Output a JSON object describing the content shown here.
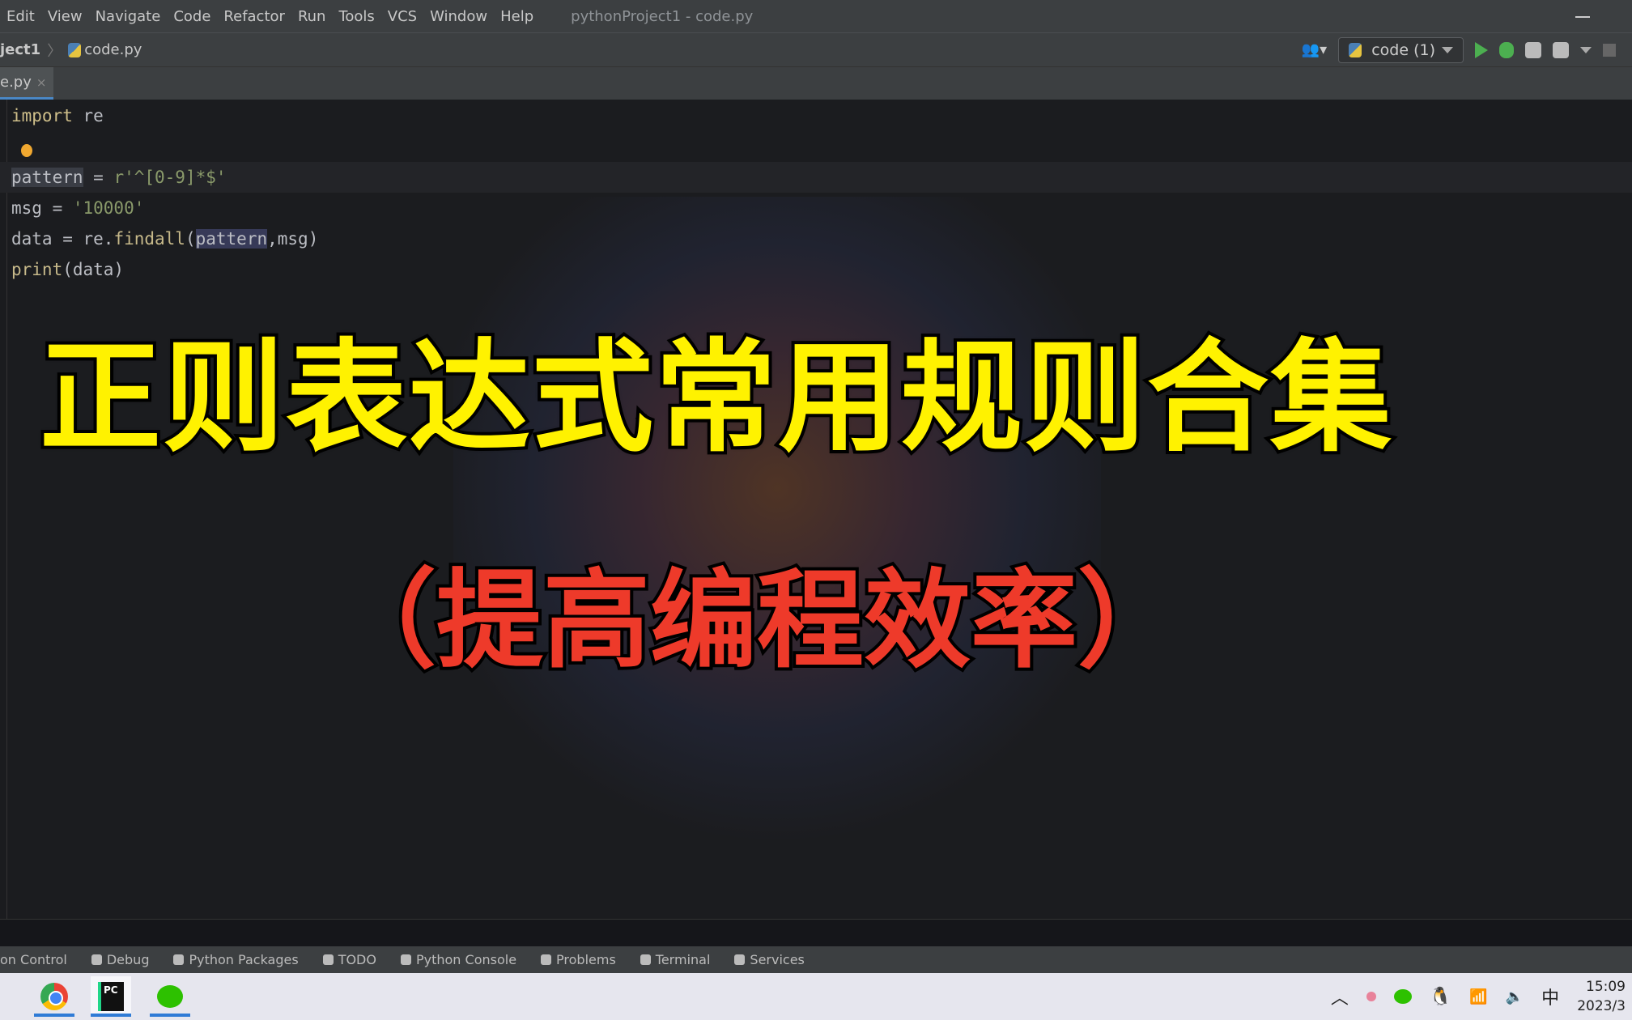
{
  "menubar": {
    "items": [
      "Edit",
      "View",
      "Navigate",
      "Code",
      "Refactor",
      "Run",
      "Tools",
      "VCS",
      "Window",
      "Help"
    ],
    "title": "pythonProject1 - code.py"
  },
  "navbar": {
    "project": "ject1",
    "file": "code.py",
    "run_config": "code (1)"
  },
  "tab": {
    "label": "e.py",
    "close": "×"
  },
  "code": {
    "line1": {
      "kw": "import",
      "rest": " re"
    },
    "line3": {
      "var": "pattern",
      "eq": " = ",
      "str": "r'^[0-9]*$'"
    },
    "line4": {
      "var": "msg = ",
      "str": "'10000'"
    },
    "line5": {
      "a": "data = re.",
      "fn": "findall",
      "b": "(",
      "hl": "pattern",
      "c": ",msg)"
    },
    "line6": {
      "fn": "print",
      "rest": "(data)"
    }
  },
  "overlay": {
    "title": "正则表达式常用规则合集",
    "subtitle": "（提高编程效率）",
    "title_color": "#fff200",
    "subtitle_color": "#ee3a2a"
  },
  "toolwindows": [
    "on Control",
    "Debug",
    "Python Packages",
    "TODO",
    "Python Console",
    "Problems",
    "Terminal",
    "Services"
  ],
  "taskbar": {
    "ime": "中",
    "time": "15:09",
    "date": "2023/3"
  }
}
